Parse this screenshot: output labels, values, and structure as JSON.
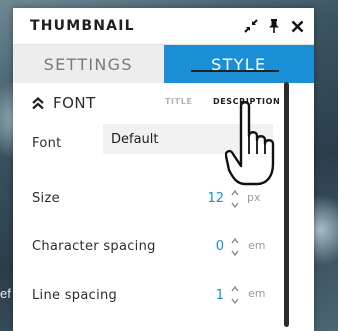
{
  "background": {
    "partial_text": "ef"
  },
  "panel": {
    "title": "THUMBNAIL",
    "icons": [
      "collapse-arrows-icon",
      "pin-icon",
      "close-icon"
    ],
    "tabs": [
      {
        "label": "SETTINGS",
        "active": false
      },
      {
        "label": "STYLE",
        "active": true
      }
    ],
    "section": {
      "label": "FONT",
      "expanded": true,
      "subtabs": [
        {
          "label": "TITLE",
          "active": false
        },
        {
          "label": "DESCRIPTION",
          "active": true
        }
      ]
    },
    "fields": {
      "font": {
        "label": "Font",
        "value": "Default"
      },
      "size": {
        "label": "Size",
        "value": "12",
        "unit": "px"
      },
      "character_spacing": {
        "label": "Character spacing",
        "value": "0",
        "unit": "em"
      },
      "line_spacing": {
        "label": "Line spacing",
        "value": "1",
        "unit": "em"
      }
    }
  },
  "colors": {
    "accent": "#1a8fd6",
    "inactive_tab_bg": "#ededed",
    "input_bg": "#f1f1f1"
  }
}
